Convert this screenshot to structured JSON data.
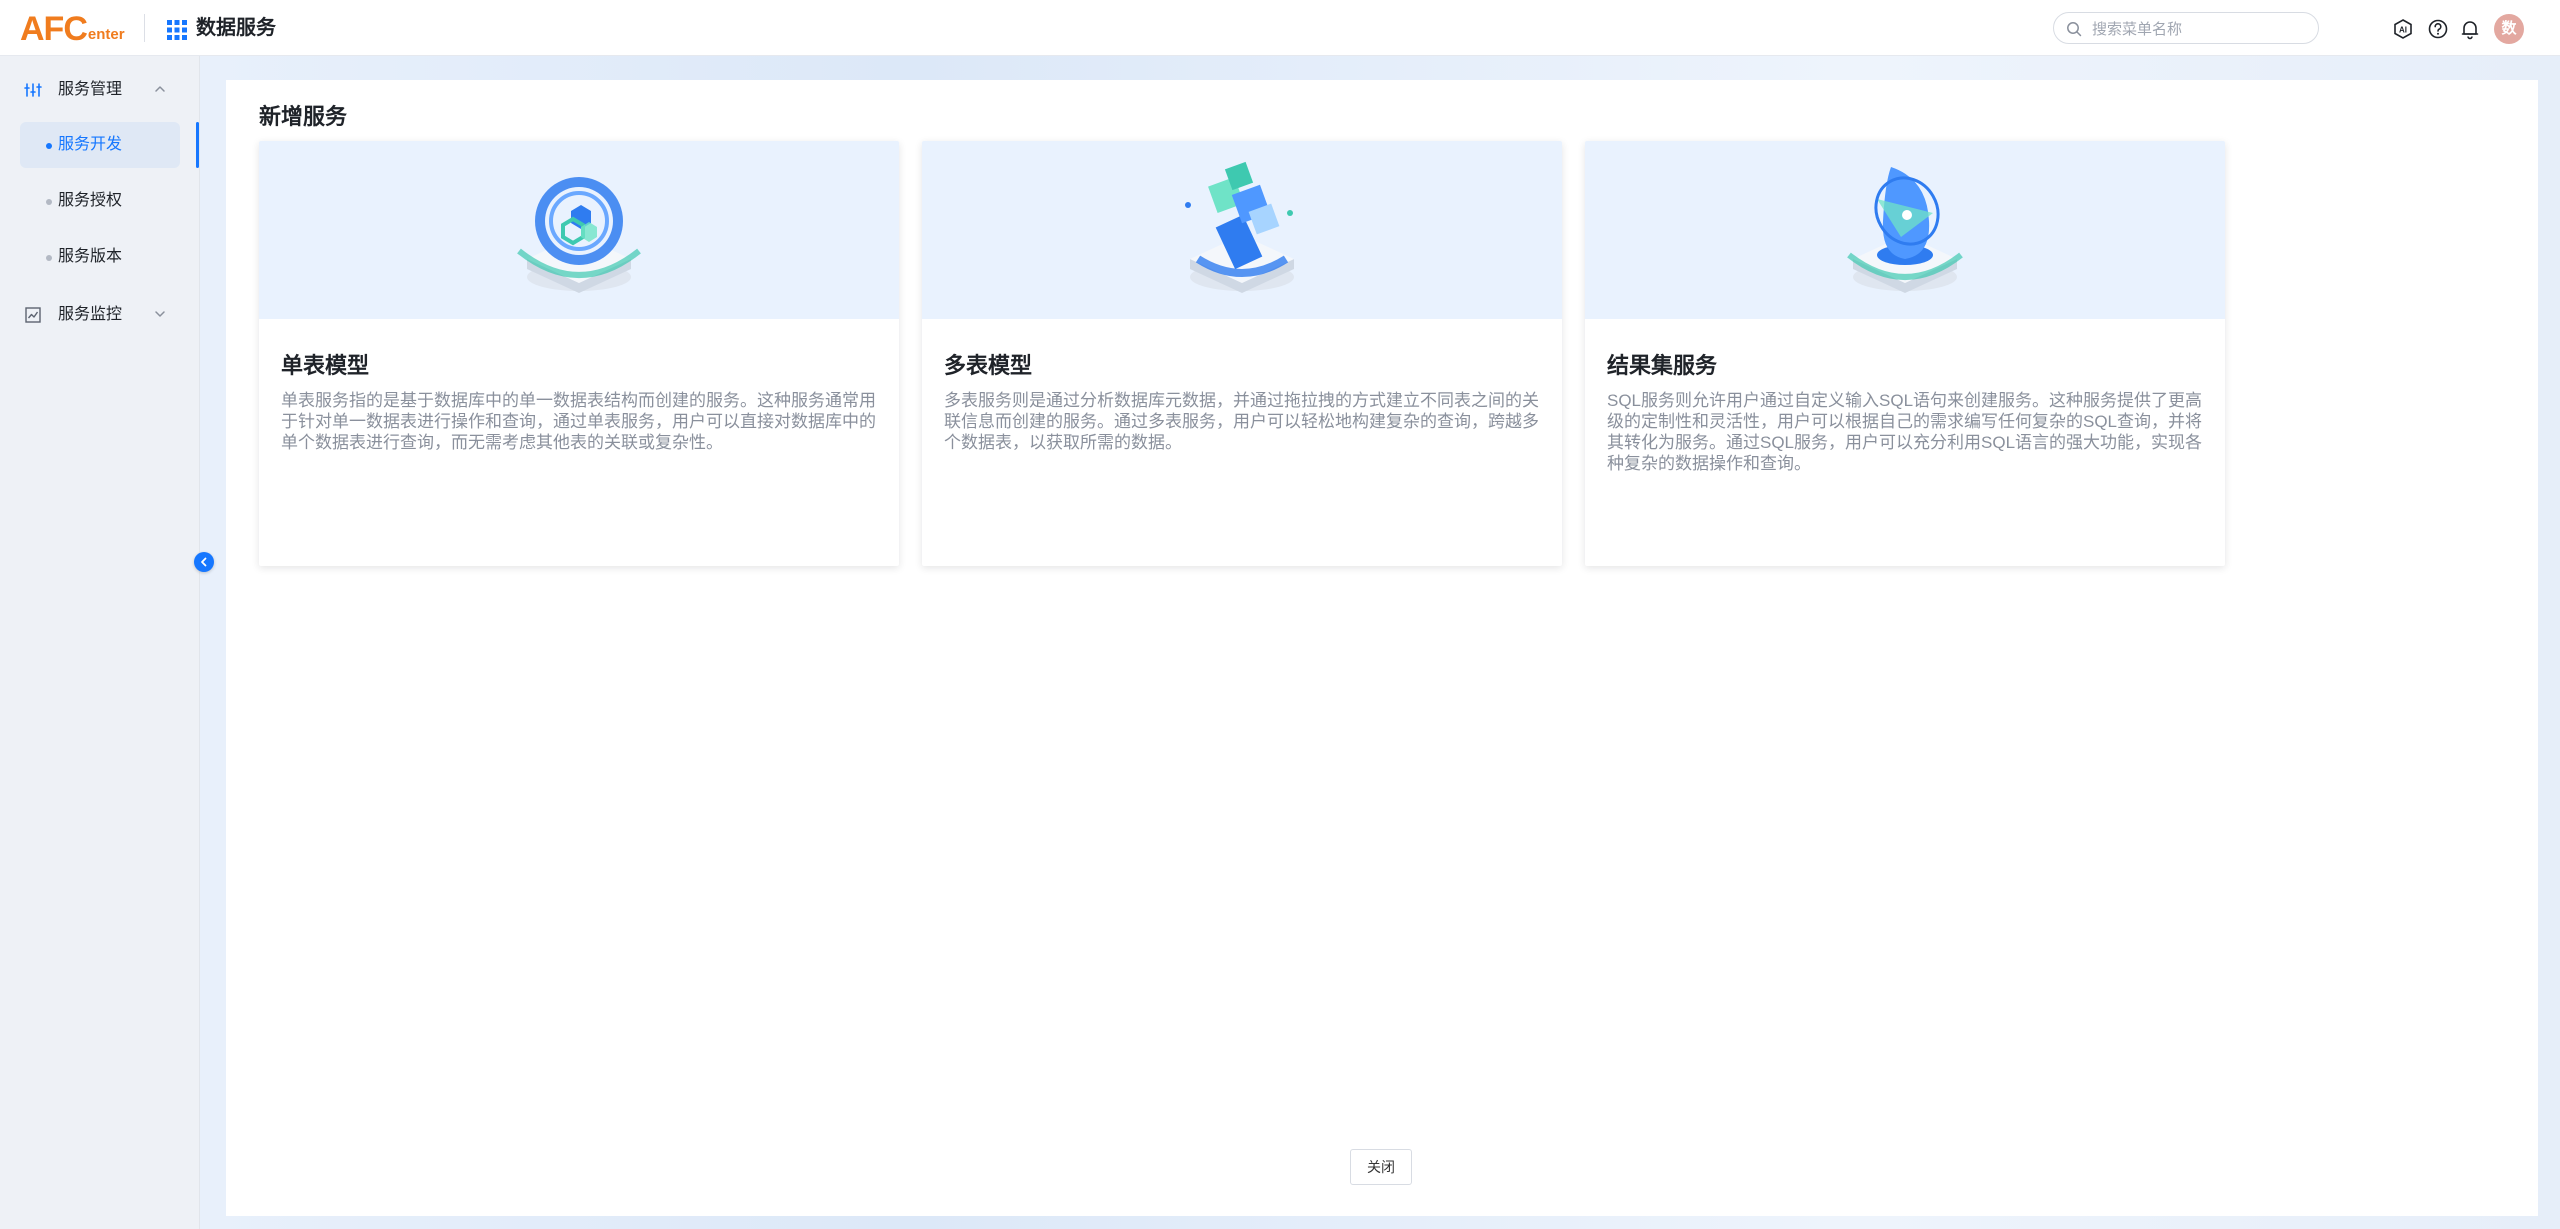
{
  "header": {
    "logo_main": "AFC",
    "logo_sub": "enter",
    "app_title": "数据服务",
    "search_placeholder": "搜索菜单名称",
    "avatar_text": "数"
  },
  "sidebar": {
    "groups": [
      {
        "label": "服务管理",
        "icon": "sliders-icon",
        "expanded": true
      },
      {
        "label": "服务监控",
        "icon": "chart-icon",
        "expanded": false
      }
    ],
    "items": [
      {
        "label": "服务开发",
        "active": true
      },
      {
        "label": "服务授权",
        "active": false
      },
      {
        "label": "服务版本",
        "active": false
      }
    ]
  },
  "main": {
    "title": "新增服务",
    "cards": [
      {
        "title": "单表模型",
        "description": "单表服务指的是基于数据库中的单一数据表结构而创建的服务。这种服务通常用于针对单一数据表进行操作和查询，通过单表服务，用户可以直接对数据库中的单个数据表进行查询，而无需考虑其他表的关联或复杂性。"
      },
      {
        "title": "多表模型",
        "description": "多表服务则是通过分析数据库元数据，并通过拖拉拽的方式建立不同表之间的关联信息而创建的服务。通过多表服务，用户可以轻松地构建复杂的查询，跨越多个数据表，以获取所需的数据。"
      },
      {
        "title": "结果集服务",
        "description": "SQL服务则允许用户通过自定义输入SQL语句来创建服务。这种服务提供了更高级的定制性和灵活性，用户可以根据自己的需求编写任何复杂的SQL查询，并将其转化为服务。通过SQL服务，用户可以充分利用SQL语言的强大功能，实现各种复杂的数据操作和查询。"
      }
    ],
    "close_label": "关闭"
  },
  "colors": {
    "accent": "#1677ff",
    "logo": "#f07c1e",
    "card_hero_bg": "#e9f2fe"
  }
}
